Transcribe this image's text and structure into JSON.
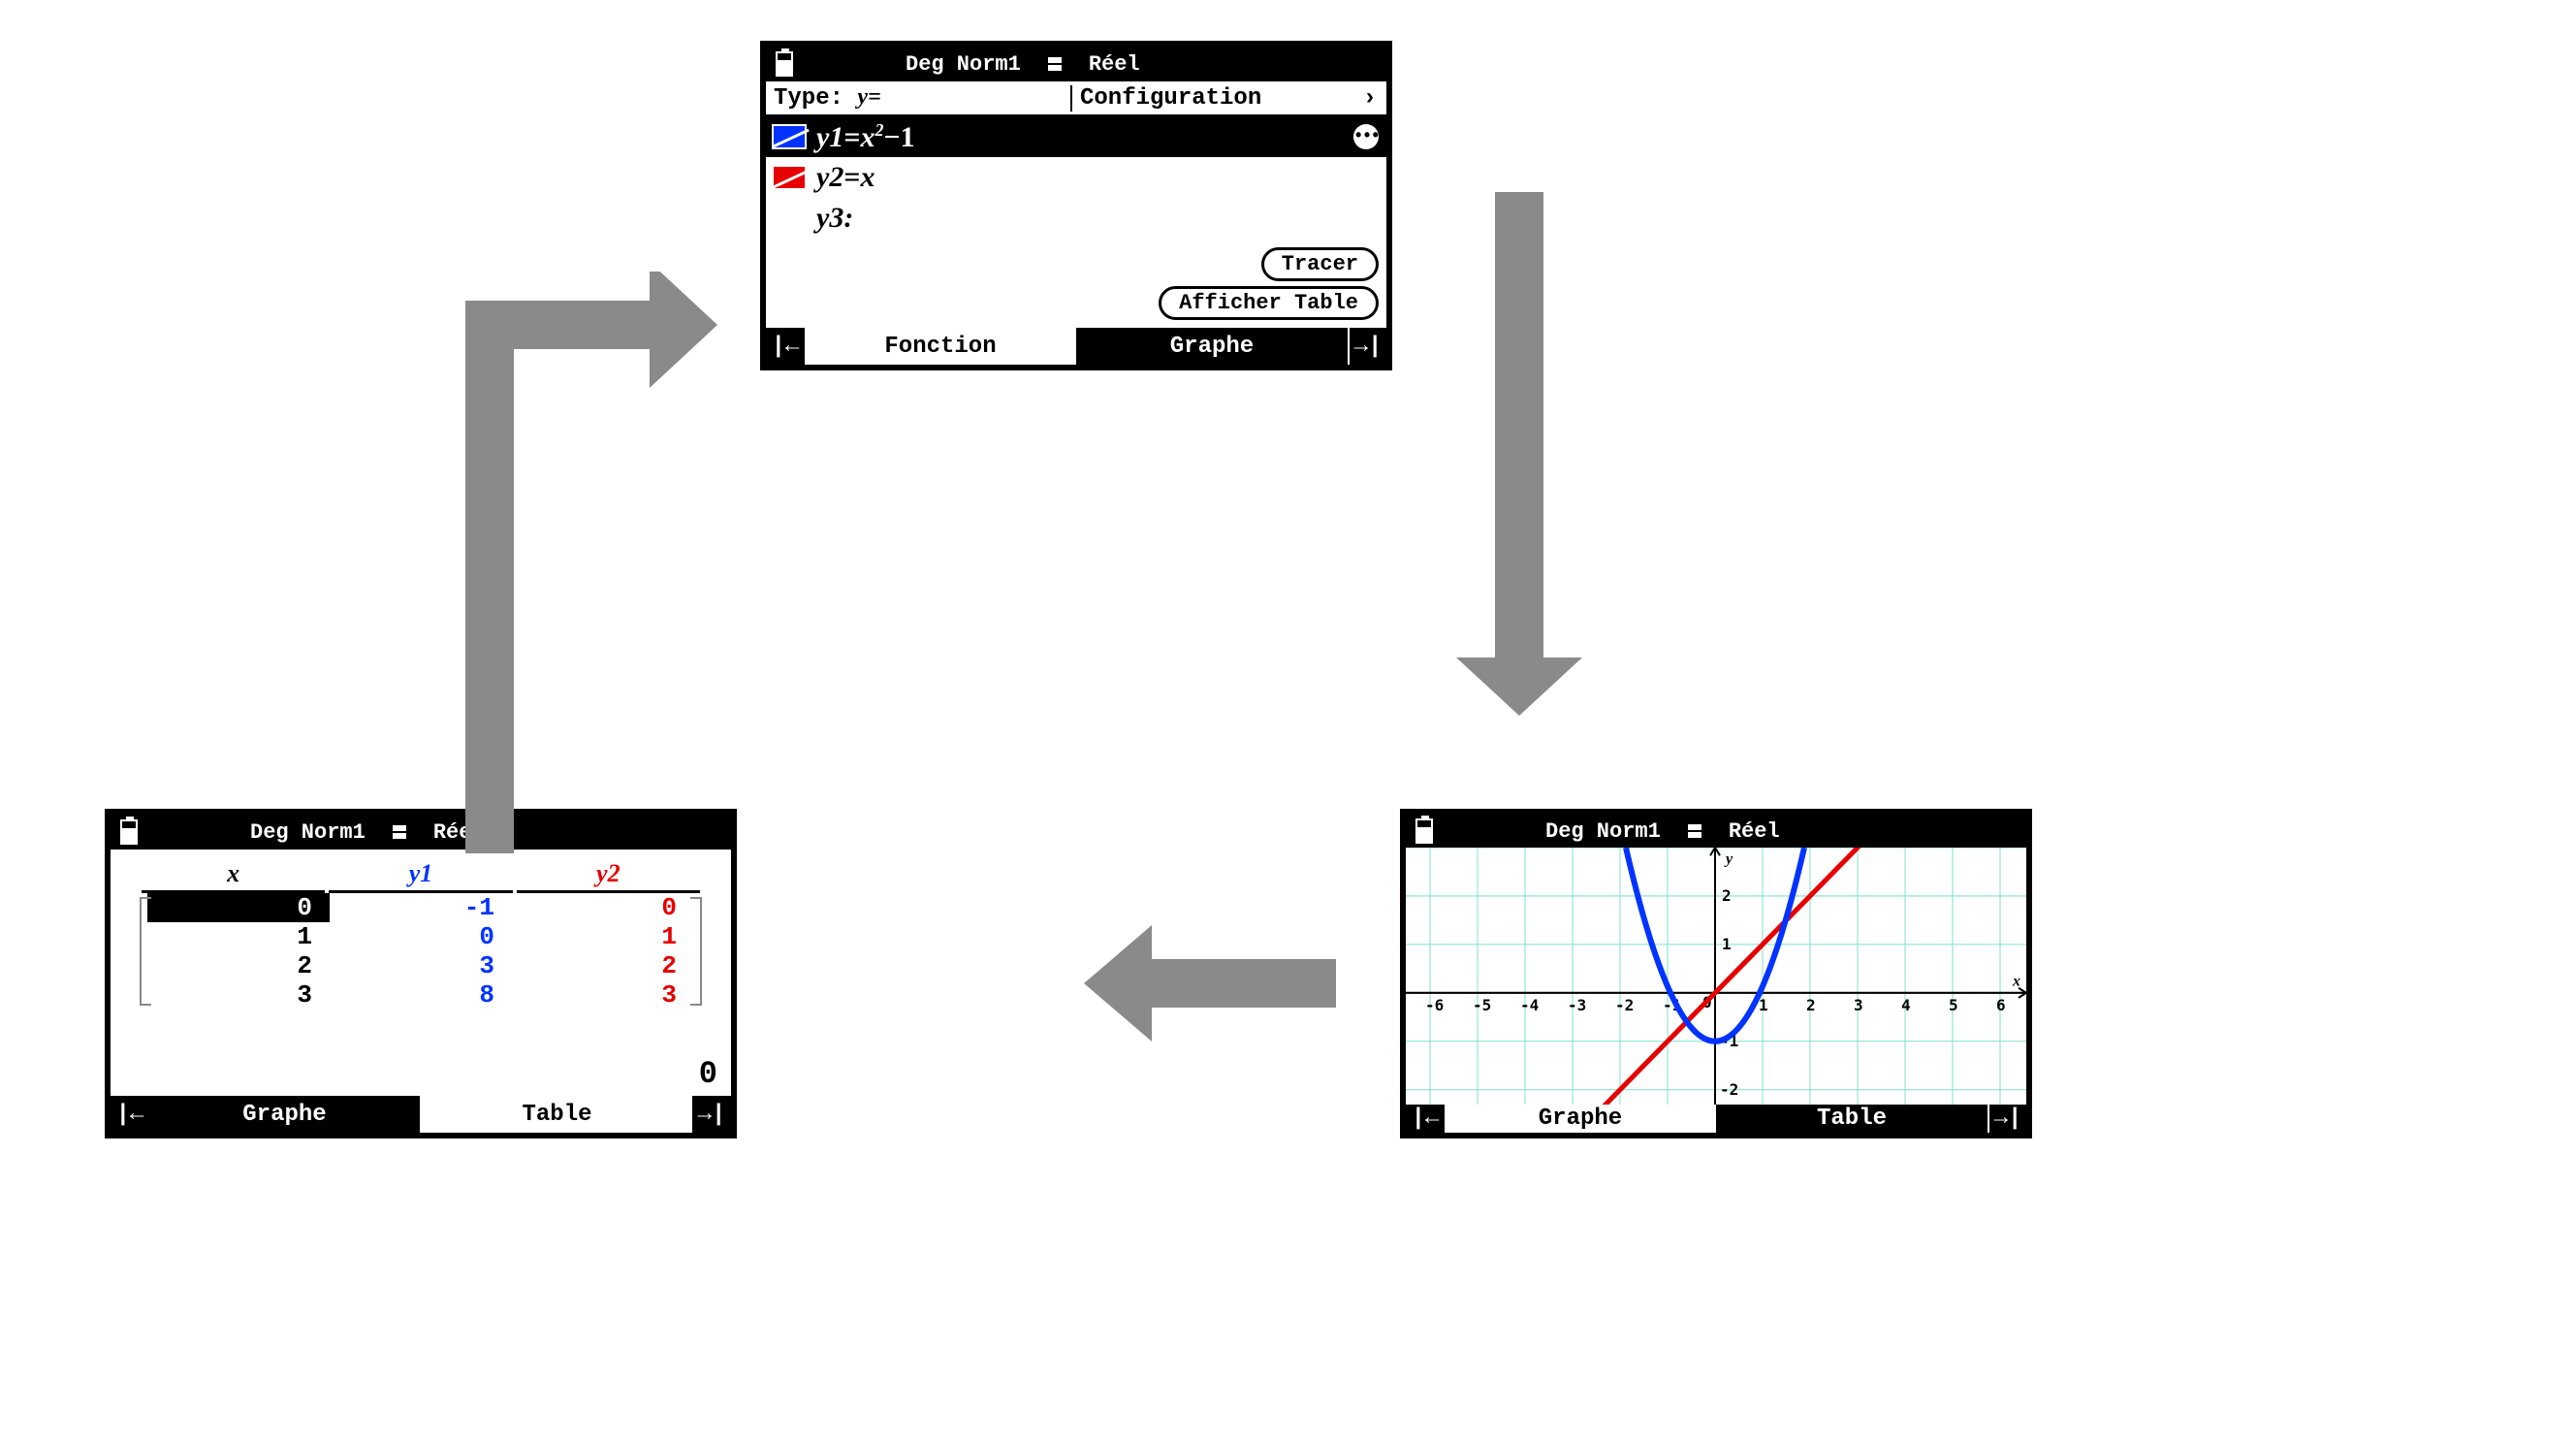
{
  "status": {
    "mode": "Deg Norm1",
    "domain": "Réel"
  },
  "function_screen": {
    "type_label": "Type: ",
    "type_value": "y=",
    "config_label": "Configuration",
    "config_arrow": "›",
    "functions": [
      {
        "name": "y1",
        "expr": "=x²−1",
        "color": "#0033ff",
        "selected": true
      },
      {
        "name": "y2",
        "expr": "=x",
        "color": "#e60000",
        "selected": false
      },
      {
        "name": "y3",
        "expr": ":",
        "color": null,
        "selected": false
      }
    ],
    "tracer_btn": "Tracer",
    "table_btn": "Afficher Table",
    "nav_left": "Fonction",
    "nav_right": "Graphe"
  },
  "graph_screen": {
    "nav_left": "Graphe",
    "nav_right": "Table",
    "x_label": "x",
    "y_label": "y"
  },
  "table_screen": {
    "headers": {
      "x": "x",
      "y1": "y1",
      "y2": "y2"
    },
    "rows": [
      {
        "x": "0",
        "y1": "-1",
        "y2": "0",
        "selected": true
      },
      {
        "x": "1",
        "y1": "0",
        "y2": "1",
        "selected": false
      },
      {
        "x": "2",
        "y1": "3",
        "y2": "2",
        "selected": false
      },
      {
        "x": "3",
        "y1": "8",
        "y2": "3",
        "selected": false
      }
    ],
    "current_value": "0",
    "nav_left": "Graphe",
    "nav_right": "Table"
  },
  "chart_data": {
    "type": "line",
    "title": "",
    "xlabel": "x",
    "ylabel": "y",
    "xlim": [
      -6.5,
      6.5
    ],
    "ylim": [
      -2.5,
      2.8
    ],
    "x_ticks": [
      -6,
      -5,
      -4,
      -3,
      -2,
      -1,
      0,
      1,
      2,
      3,
      4,
      5,
      6
    ],
    "y_ticks": [
      -2,
      -1,
      0,
      1,
      2
    ],
    "grid": true,
    "series": [
      {
        "name": "y1",
        "color": "#0033ff",
        "expr": "x^2 - 1",
        "type": "parabola"
      },
      {
        "name": "y2",
        "color": "#e60000",
        "expr": "x",
        "type": "line"
      }
    ]
  },
  "nav_arrows": {
    "left": "|←",
    "right": "→|"
  }
}
